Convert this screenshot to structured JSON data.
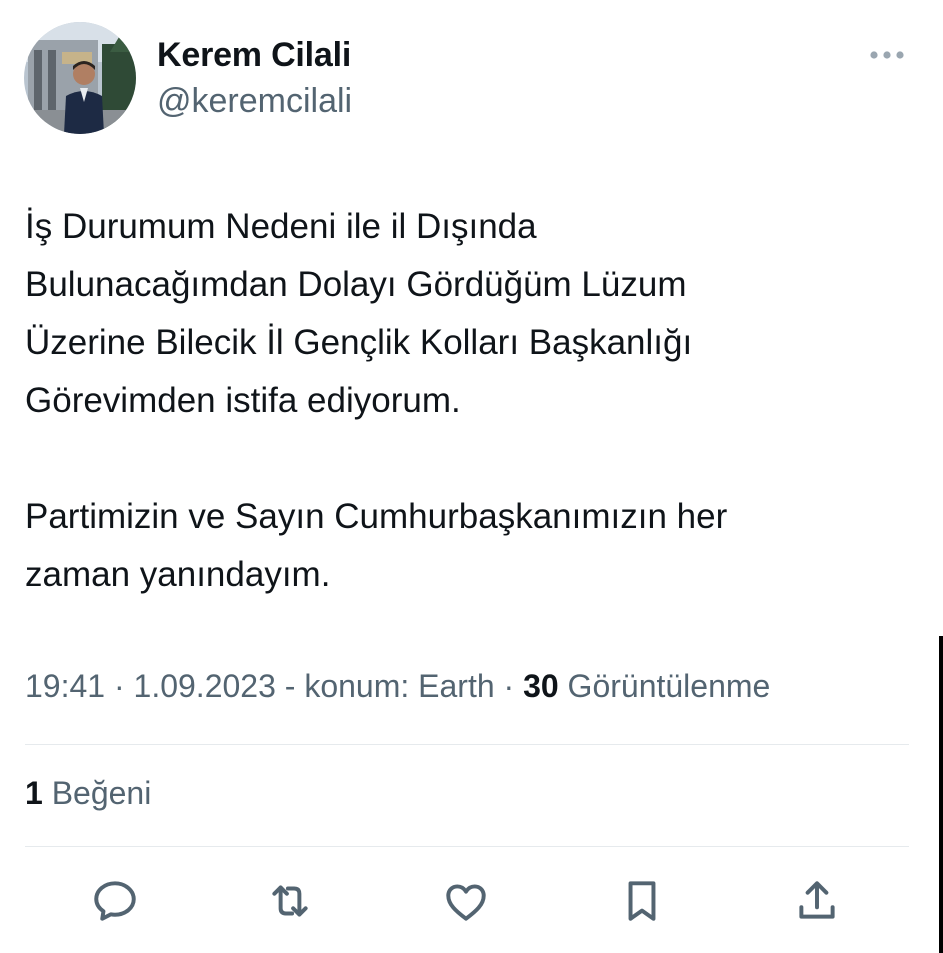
{
  "author": {
    "name": "Kerem Cilali",
    "handle": "@keremcilali"
  },
  "tweet": {
    "text": "İş Durumum Nedeni ile il Dışında\nBulunacağımdan Dolayı Gördüğüm Lüzum\nÜzerine Bilecik İl Gençlik Kolları Başkanlığı\nGörevimden istifa ediyorum.\n\nPartimizin ve Sayın Cumhurbaşkanımızın her\nzaman yanındayım."
  },
  "meta": {
    "time": "19:41",
    "date": "1.09.2023",
    "location": "konum: Earth",
    "views_count": "30",
    "views_label": "Görüntülenme"
  },
  "engagement": {
    "likes_count": "1",
    "likes_label": "Beğeni"
  },
  "icons": {
    "more": "more-icon",
    "reply": "reply-icon",
    "retweet": "retweet-icon",
    "like": "like-icon",
    "bookmark": "bookmark-icon",
    "share": "share-icon"
  },
  "colors": {
    "text_primary": "#0f1419",
    "text_secondary": "#536471",
    "divider": "#e6eaed"
  }
}
